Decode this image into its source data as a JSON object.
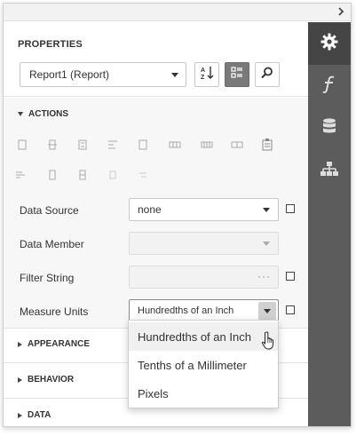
{
  "panel": {
    "title": "PROPERTIES",
    "object_select": {
      "value": "Report1 (Report)"
    }
  },
  "toolbar": {
    "sort_icon": "sort-alphabetical-icon",
    "categories_icon": "categories-icon",
    "search_icon": "search-icon"
  },
  "rail": {
    "tabs": [
      {
        "icon": "gear-icon",
        "active": true
      },
      {
        "icon": "function-icon",
        "active": false
      },
      {
        "icon": "database-icon",
        "active": false
      },
      {
        "icon": "hierarchy-icon",
        "active": false
      }
    ]
  },
  "sections": {
    "actions": "ACTIONS",
    "appearance": "APPEARANCE",
    "behavior": "BEHAVIOR",
    "data": "DATA"
  },
  "properties": [
    {
      "label": "Data Source",
      "value": "none"
    },
    {
      "label": "Data Member",
      "value": ""
    },
    {
      "label": "Filter String",
      "value": ""
    },
    {
      "label": "Measure Units",
      "value": "Hundredths of an Inch"
    }
  ],
  "dropdown": {
    "options": [
      "Hundredths of an Inch",
      "Tenths of a Millimeter",
      "Pixels"
    ],
    "hovered_index": 0
  },
  "colors": {
    "rail_bg": "#5c5c5c",
    "rail_active": "#454545",
    "accent": "#333333"
  }
}
